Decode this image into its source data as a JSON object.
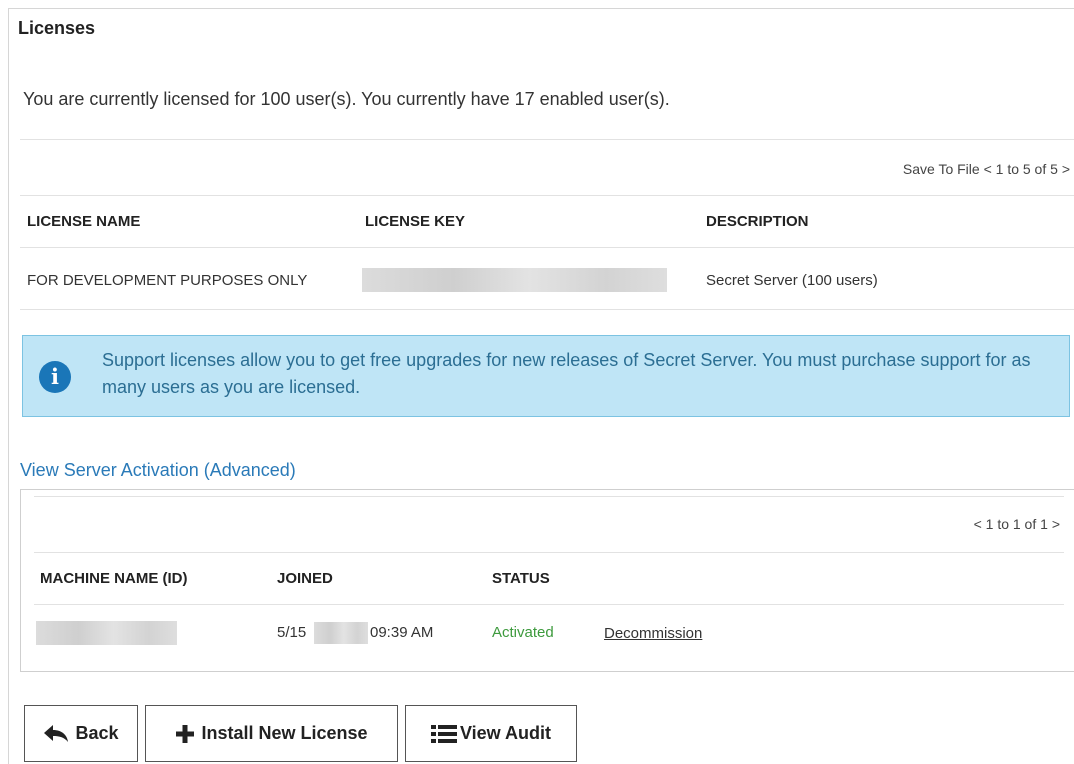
{
  "page": {
    "title": "Licenses",
    "summary": "You are currently licensed for 100 user(s). You currently have 17 enabled user(s)."
  },
  "licenses_table": {
    "toolbar": {
      "save_to_file": "Save To File",
      "prev": "<",
      "range": "1 to 5 of 5",
      "next": ">"
    },
    "columns": [
      "LICENSE NAME",
      "LICENSE KEY",
      "DESCRIPTION"
    ],
    "rows": [
      {
        "name": "FOR DEVELOPMENT PURPOSES ONLY",
        "key": "",
        "description": "Secret Server (100 users)"
      }
    ]
  },
  "info_box": {
    "icon": "info-icon",
    "glyph": "i",
    "text": "Support licenses allow you to get free upgrades for new releases of Secret Server. You must purchase support for as many users as you are licensed."
  },
  "activation": {
    "link_label": "View Server Activation (Advanced)",
    "pager": {
      "prev": "<",
      "range": "1 to 1 of 1",
      "next": ">"
    },
    "columns": [
      "MACHINE NAME (ID)",
      "JOINED",
      "STATUS"
    ],
    "rows": [
      {
        "machine": "",
        "joined_date": "5/15",
        "joined_time": "09:39 AM",
        "status": "Activated",
        "action": "Decommission"
      }
    ],
    "status_color": "#3d9a3d"
  },
  "buttons": {
    "back": {
      "label": "Back",
      "icon": "back-arrow-icon"
    },
    "install": {
      "label": "Install New License",
      "icon": "plus-icon"
    },
    "audit": {
      "label": "View Audit",
      "icon": "list-icon"
    }
  },
  "colors": {
    "info_bg": "#bfe5f6",
    "info_border": "#7cc3e2",
    "info_icon": "#1a76b8",
    "link": "#2a7ab8"
  }
}
